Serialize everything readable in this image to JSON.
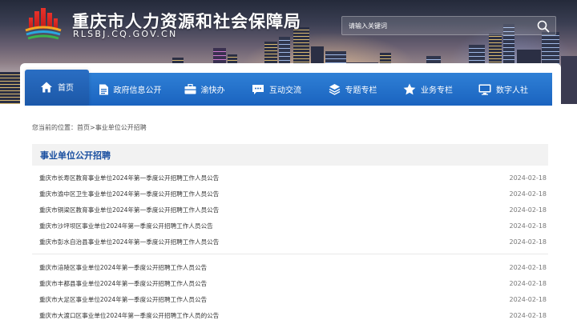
{
  "header": {
    "site_title": "重庆市人力资源和社会保障局",
    "site_domain": "RLSBJ.CQ.GOV.CN",
    "search_placeholder": "请输入关键词"
  },
  "nav": {
    "items": [
      {
        "label": "首页",
        "icon": "home-icon"
      },
      {
        "label": "政府信息公开",
        "icon": "document-icon"
      },
      {
        "label": "渝快办",
        "icon": "briefcase-icon"
      },
      {
        "label": "互动交流",
        "icon": "chat-icon"
      },
      {
        "label": "专题专栏",
        "icon": "layers-icon"
      },
      {
        "label": "业务专栏",
        "icon": "star-icon"
      },
      {
        "label": "数字人社",
        "icon": "monitor-icon"
      }
    ]
  },
  "breadcrumb": {
    "prefix": "您当前的位置：",
    "home": "首页",
    "separator": ">",
    "current": "事业单位公开招聘"
  },
  "section": {
    "title": "事业单位公开招聘"
  },
  "list": {
    "group1": [
      {
        "title": "重庆市长寿区教育事业单位2024年第一季度公开招聘工作人员公告",
        "date": "2024-02-18"
      },
      {
        "title": "重庆市渝中区卫生事业单位2024年第一季度公开招聘工作人员公告",
        "date": "2024-02-18"
      },
      {
        "title": "重庆市铜梁区教育事业单位2024年第一季度公开招聘工作人员公告",
        "date": "2024-02-18"
      },
      {
        "title": "重庆市沙坪坝区事业单位2024年第一季度公开招聘工作人员公告",
        "date": "2024-02-18"
      },
      {
        "title": "重庆市彭水自治县事业单位2024年第一季度公开招聘工作人员公告",
        "date": "2024-02-18"
      }
    ],
    "group2": [
      {
        "title": "重庆市涪陵区事业单位2024年第一季度公开招聘工作人员公告",
        "date": "2024-02-18"
      },
      {
        "title": "重庆市丰都县事业单位2024年第一季度公开招聘工作人员公告",
        "date": "2024-02-18"
      },
      {
        "title": "重庆市大足区事业单位2024年第一季度公开招聘工作人员公告",
        "date": "2024-02-18"
      },
      {
        "title": "重庆市大渡口区事业单位2024年第一季度公开招聘工作人员的公告",
        "date": "2024-02-18"
      }
    ]
  },
  "colors": {
    "nav_blue": "#1a63bf",
    "section_title": "#1a4fa0"
  }
}
